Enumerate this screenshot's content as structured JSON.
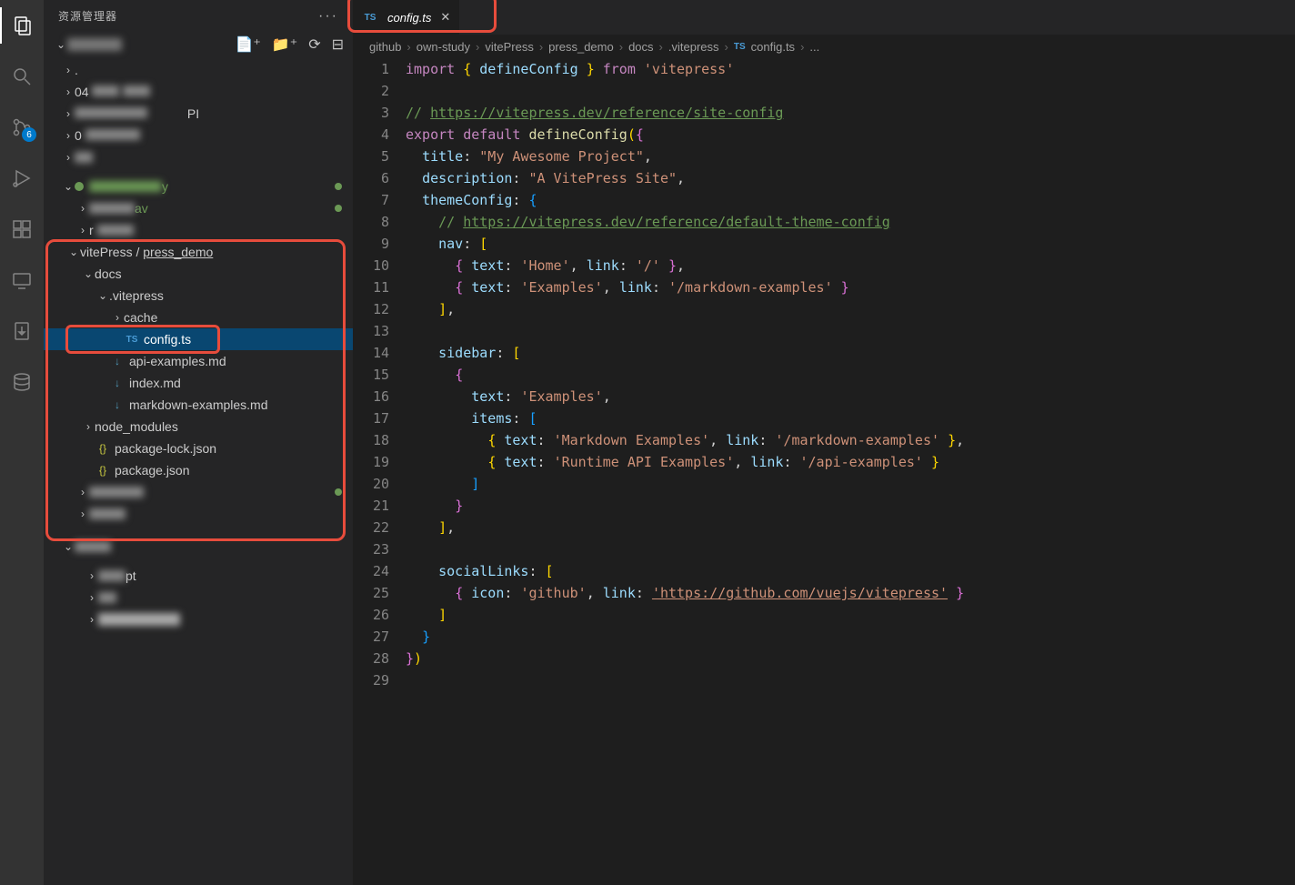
{
  "activityBar": {
    "badge": "6"
  },
  "sidebar": {
    "title": "资源管理器",
    "more": "···",
    "tree": {
      "dot": ".",
      "zeroFour": "04",
      "pi": "PI",
      "zero": "0",
      "y": "y",
      "av": "av",
      "r": "r",
      "vitePress": "vitePress",
      "pressDemo": "press_demo",
      "slash": " / ",
      "docs": "docs",
      "vitepressDir": ".vitepress",
      "cache": "cache",
      "configTs": "config.ts",
      "apiExamples": "api-examples.md",
      "indexMd": "index.md",
      "mdExamples": "markdown-examples.md",
      "nodeModules": "node_modules",
      "pkgLock": "package-lock.json",
      "pkg": "package.json",
      "pt": "pt"
    }
  },
  "tab": {
    "label": "config.ts",
    "icon": "TS"
  },
  "breadcrumbs": [
    "github",
    "own-study",
    "vitePress",
    "press_demo",
    "docs",
    ".vitepress",
    "config.ts",
    "..."
  ],
  "code": {
    "lines": [
      {
        "n": 1
      },
      {
        "n": 2
      },
      {
        "n": 3
      },
      {
        "n": 4
      },
      {
        "n": 5
      },
      {
        "n": 6
      },
      {
        "n": 7
      },
      {
        "n": 8
      },
      {
        "n": 9
      },
      {
        "n": 10
      },
      {
        "n": 11
      },
      {
        "n": 12
      },
      {
        "n": 13
      },
      {
        "n": 14
      },
      {
        "n": 15
      },
      {
        "n": 16
      },
      {
        "n": 17
      },
      {
        "n": 18
      },
      {
        "n": 19
      },
      {
        "n": 20
      },
      {
        "n": 21
      },
      {
        "n": 22
      },
      {
        "n": 23
      },
      {
        "n": 24
      },
      {
        "n": 25
      },
      {
        "n": 26
      },
      {
        "n": 27
      },
      {
        "n": 28
      },
      {
        "n": 29
      }
    ],
    "t": {
      "import": "import",
      "defineConfig": "defineConfig",
      "from": "from",
      "vitepress": "'vitepress'",
      "siteConfigComment": "// ",
      "siteConfigUrl": "https://vitepress.dev/reference/site-config",
      "export": "export",
      "default": "default",
      "title": "title",
      "titleVal": "\"My Awesome Project\"",
      "description": "description",
      "descVal": "\"A VitePress Site\"",
      "themeConfig": "themeConfig",
      "themeConfigUrl": "https://vitepress.dev/reference/default-theme-config",
      "nav": "nav",
      "text": "text",
      "link": "link",
      "home": "'Home'",
      "slash": "'/'",
      "examples": "'Examples'",
      "mdExamplesLink": "'/markdown-examples'",
      "sidebar": "sidebar",
      "items": "items",
      "mdExamples": "'Markdown Examples'",
      "runtimeApi": "'Runtime API Examples'",
      "apiExamplesLink": "'/api-examples'",
      "socialLinks": "socialLinks",
      "icon": "icon",
      "github": "'github'",
      "githubUrl": "'https://github.com/vuejs/vitepress'"
    }
  }
}
